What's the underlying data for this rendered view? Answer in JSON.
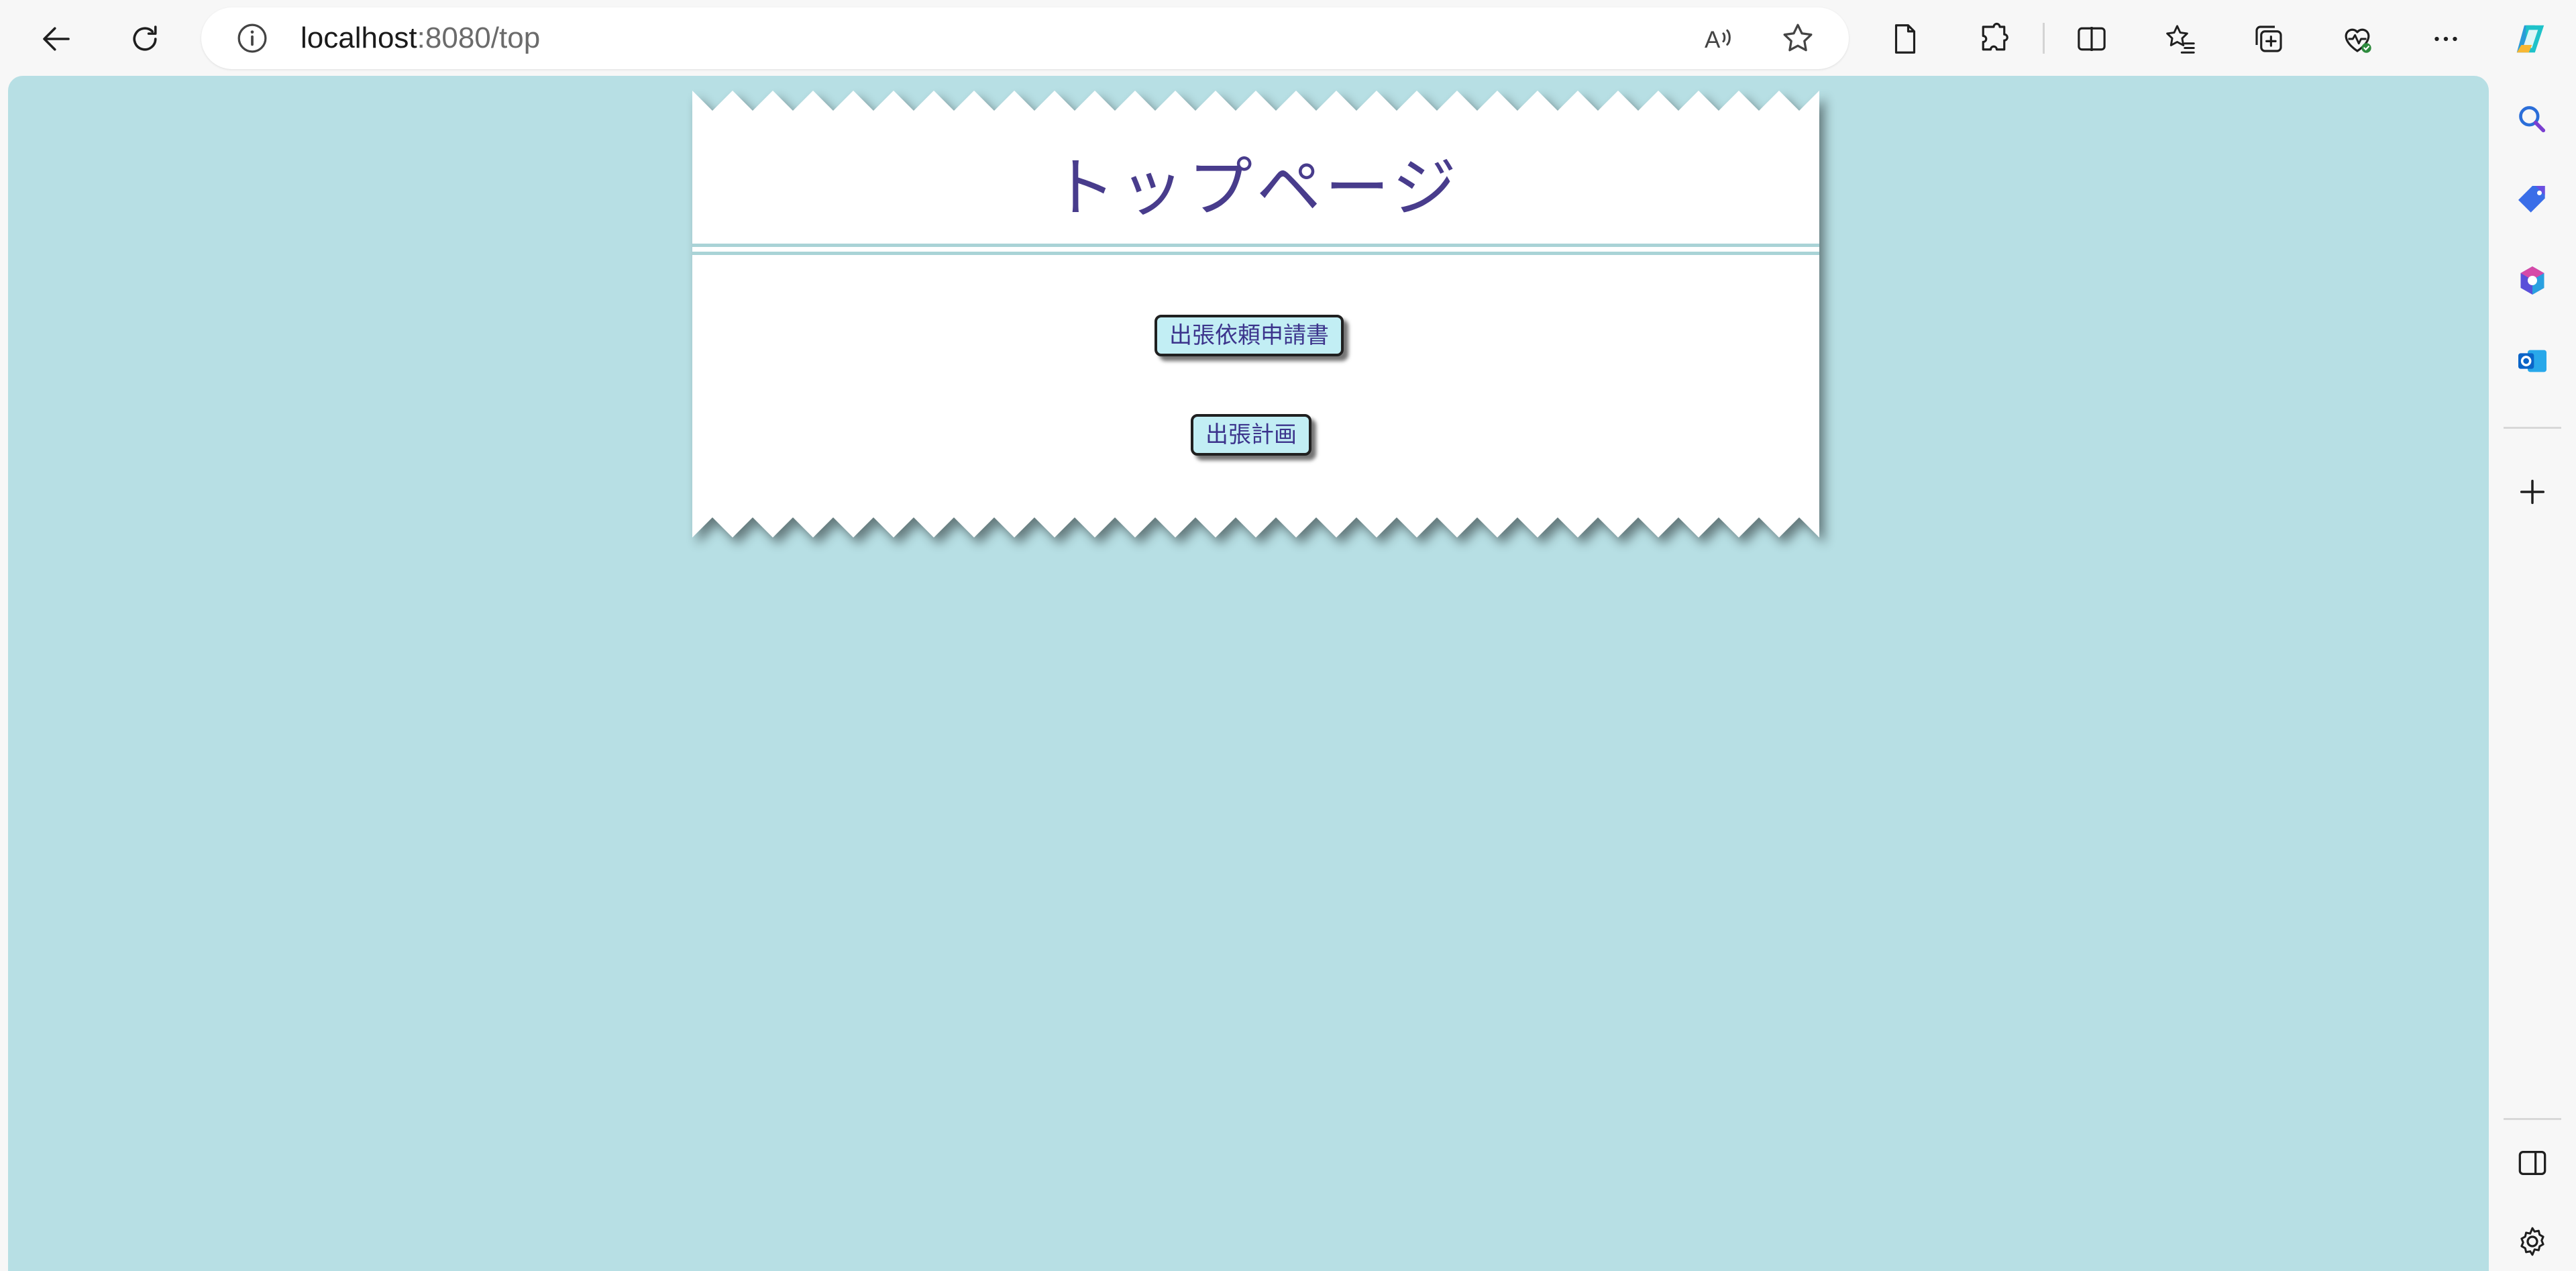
{
  "browser": {
    "address": {
      "host": "localhost",
      "rest": ":8080/top"
    },
    "toolbar_icons": [
      "back-arrow-icon",
      "refresh-icon",
      "site-info-icon",
      "read-aloud-icon",
      "favorite-star-icon",
      "page-icon",
      "extensions-icon",
      "split-screen-icon",
      "favorites-icon",
      "collections-icon",
      "browser-essentials-icon",
      "more-icon",
      "copilot-icon"
    ],
    "sidebar_icons": [
      "search-icon",
      "shopping-tag-icon",
      "m365-icon",
      "outlook-icon",
      "add-icon",
      "hide-sidebar-icon",
      "settings-icon"
    ]
  },
  "page": {
    "title": "トップページ",
    "buttons": {
      "business_trip_request": "出張依頼申請書",
      "business_trip_plan": "出張計画"
    }
  },
  "colors": {
    "background": "#b7dfe4",
    "title": "#483c8c",
    "button_fill": "#c2eef4",
    "button_text": "#3c348c"
  }
}
